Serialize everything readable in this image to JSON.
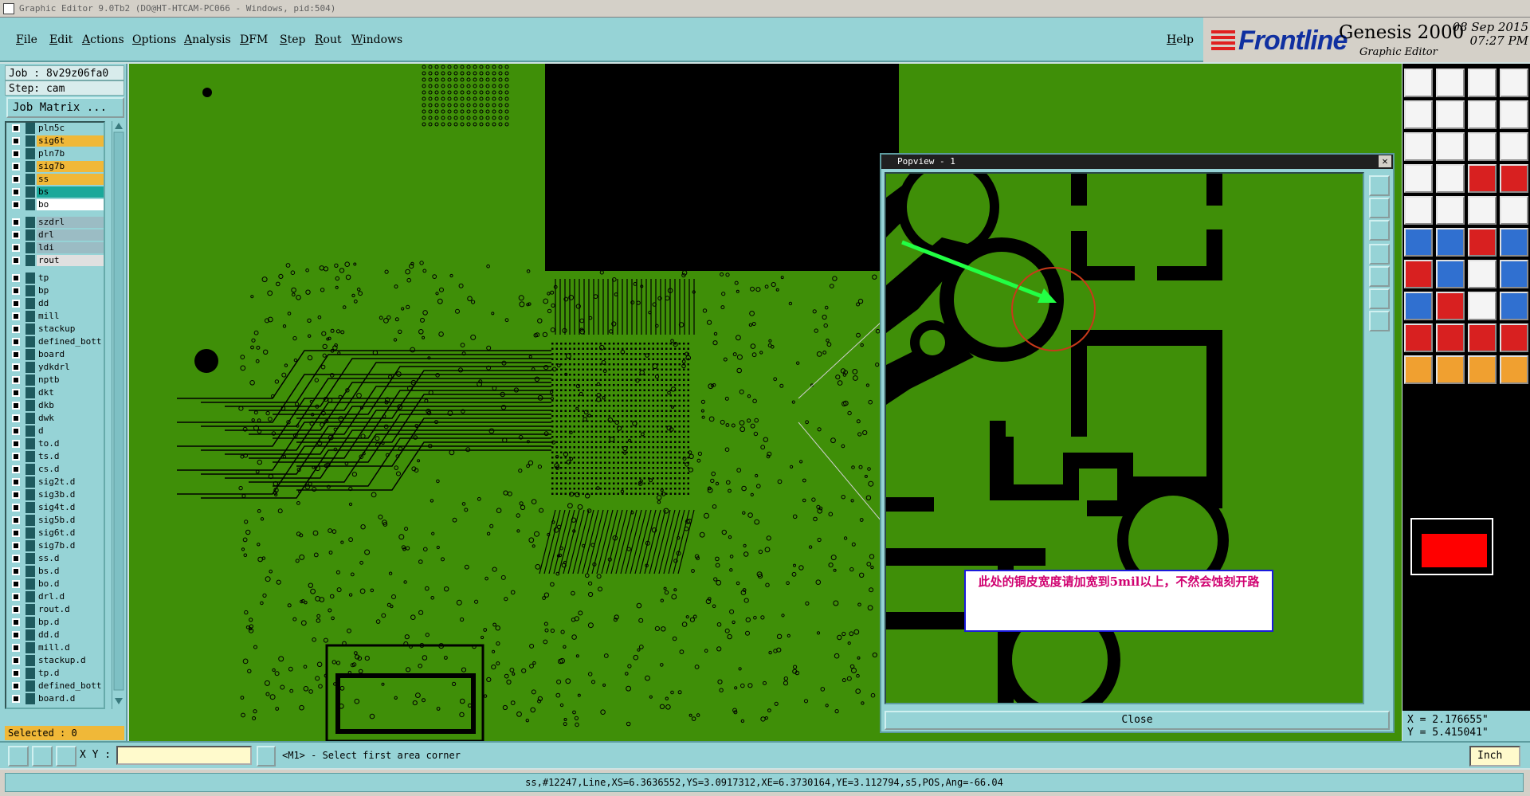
{
  "title_bar": {
    "text": "Graphic Editor 9.0Tb2 (DO@HT-HTCAM-PC066 - Windows, pid:504)"
  },
  "menu": {
    "items": [
      "File",
      "Edit",
      "Actions",
      "Options",
      "Analysis",
      "DFM",
      "Step",
      "Rout",
      "Windows"
    ],
    "help": "Help"
  },
  "brand": {
    "logo": "Frontline",
    "product": "Genesis 2000",
    "subtitle": "Graphic Editor",
    "date": "08 Sep 2015",
    "time": "07:27 PM"
  },
  "job": {
    "job_label": "Job : 8v29z06fa0",
    "step_label": "Step: cam",
    "matrix_button": "Job Matrix ..."
  },
  "layers": [
    {
      "name": "pln5c",
      "color": "#96d3d6"
    },
    {
      "name": "sig6t",
      "color": "#f0b838"
    },
    {
      "name": "pln7b",
      "color": "#96d3d6"
    },
    {
      "name": "sig7b",
      "color": "#f0b838"
    },
    {
      "name": "ss",
      "color": "#f0b838"
    },
    {
      "name": "bs",
      "color": "#1aa89a"
    },
    {
      "name": "bo",
      "color": "#ffffff"
    },
    {
      "name": "szdrl",
      "color": "#9bbcc4"
    },
    {
      "name": "drl",
      "color": "#9bbcc4"
    },
    {
      "name": "ldi",
      "color": "#9bbcc4"
    },
    {
      "name": "rout",
      "color": "#e0e0e0"
    },
    {
      "name": "tp",
      "color": "#96d3d6"
    },
    {
      "name": "bp",
      "color": "#96d3d6"
    },
    {
      "name": "dd",
      "color": "#96d3d6"
    },
    {
      "name": "mill",
      "color": "#96d3d6"
    },
    {
      "name": "stackup",
      "color": "#96d3d6"
    },
    {
      "name": "defined_bott",
      "color": "#96d3d6"
    },
    {
      "name": "board",
      "color": "#96d3d6"
    },
    {
      "name": "ydkdrl",
      "color": "#96d3d6"
    },
    {
      "name": "nptb",
      "color": "#96d3d6"
    },
    {
      "name": "dkt",
      "color": "#96d3d6"
    },
    {
      "name": "dkb",
      "color": "#96d3d6"
    },
    {
      "name": "dwk",
      "color": "#96d3d6"
    },
    {
      "name": "d",
      "color": "#96d3d6"
    },
    {
      "name": "to.d",
      "color": "#96d3d6"
    },
    {
      "name": "ts.d",
      "color": "#96d3d6"
    },
    {
      "name": "cs.d",
      "color": "#96d3d6"
    },
    {
      "name": "sig2t.d",
      "color": "#96d3d6"
    },
    {
      "name": "sig3b.d",
      "color": "#96d3d6"
    },
    {
      "name": "sig4t.d",
      "color": "#96d3d6"
    },
    {
      "name": "sig5b.d",
      "color": "#96d3d6"
    },
    {
      "name": "sig6t.d",
      "color": "#96d3d6"
    },
    {
      "name": "sig7b.d",
      "color": "#96d3d6"
    },
    {
      "name": "ss.d",
      "color": "#96d3d6"
    },
    {
      "name": "bs.d",
      "color": "#96d3d6"
    },
    {
      "name": "bo.d",
      "color": "#96d3d6"
    },
    {
      "name": "drl.d",
      "color": "#96d3d6"
    },
    {
      "name": "rout.d",
      "color": "#96d3d6"
    },
    {
      "name": "bp.d",
      "color": "#96d3d6"
    },
    {
      "name": "dd.d",
      "color": "#96d3d6"
    },
    {
      "name": "mill.d",
      "color": "#96d3d6"
    },
    {
      "name": "stackup.d",
      "color": "#96d3d6"
    },
    {
      "name": "tp.d",
      "color": "#96d3d6"
    },
    {
      "name": "defined_bott",
      "color": "#96d3d6"
    },
    {
      "name": "board.d",
      "color": "#96d3d6"
    }
  ],
  "selected": "Selected : 0",
  "popview": {
    "title": "Popview - 1",
    "close_button": "Close",
    "note": "此处的铜皮宽度请加宽到5mil以上，不然会蚀刻开路"
  },
  "coords": {
    "x": "X = 2.176655\"",
    "y": "Y = 5.415041\""
  },
  "command": {
    "xy_label": "X Y :",
    "xy_value": "",
    "message": "<M1> - Select first area corner",
    "units": "Inch"
  },
  "status": "ss,#12247,Line,XS=6.3636552,YS=3.0917312,XE=6.3730164,YE=3.112794,s5,POS,Ang=-66.04",
  "colors": {
    "board_green": "#3f8f08",
    "panel_cyan": "#96d3d6",
    "highlight_red": "#c83a1a",
    "arrow_green": "#22ff44"
  }
}
